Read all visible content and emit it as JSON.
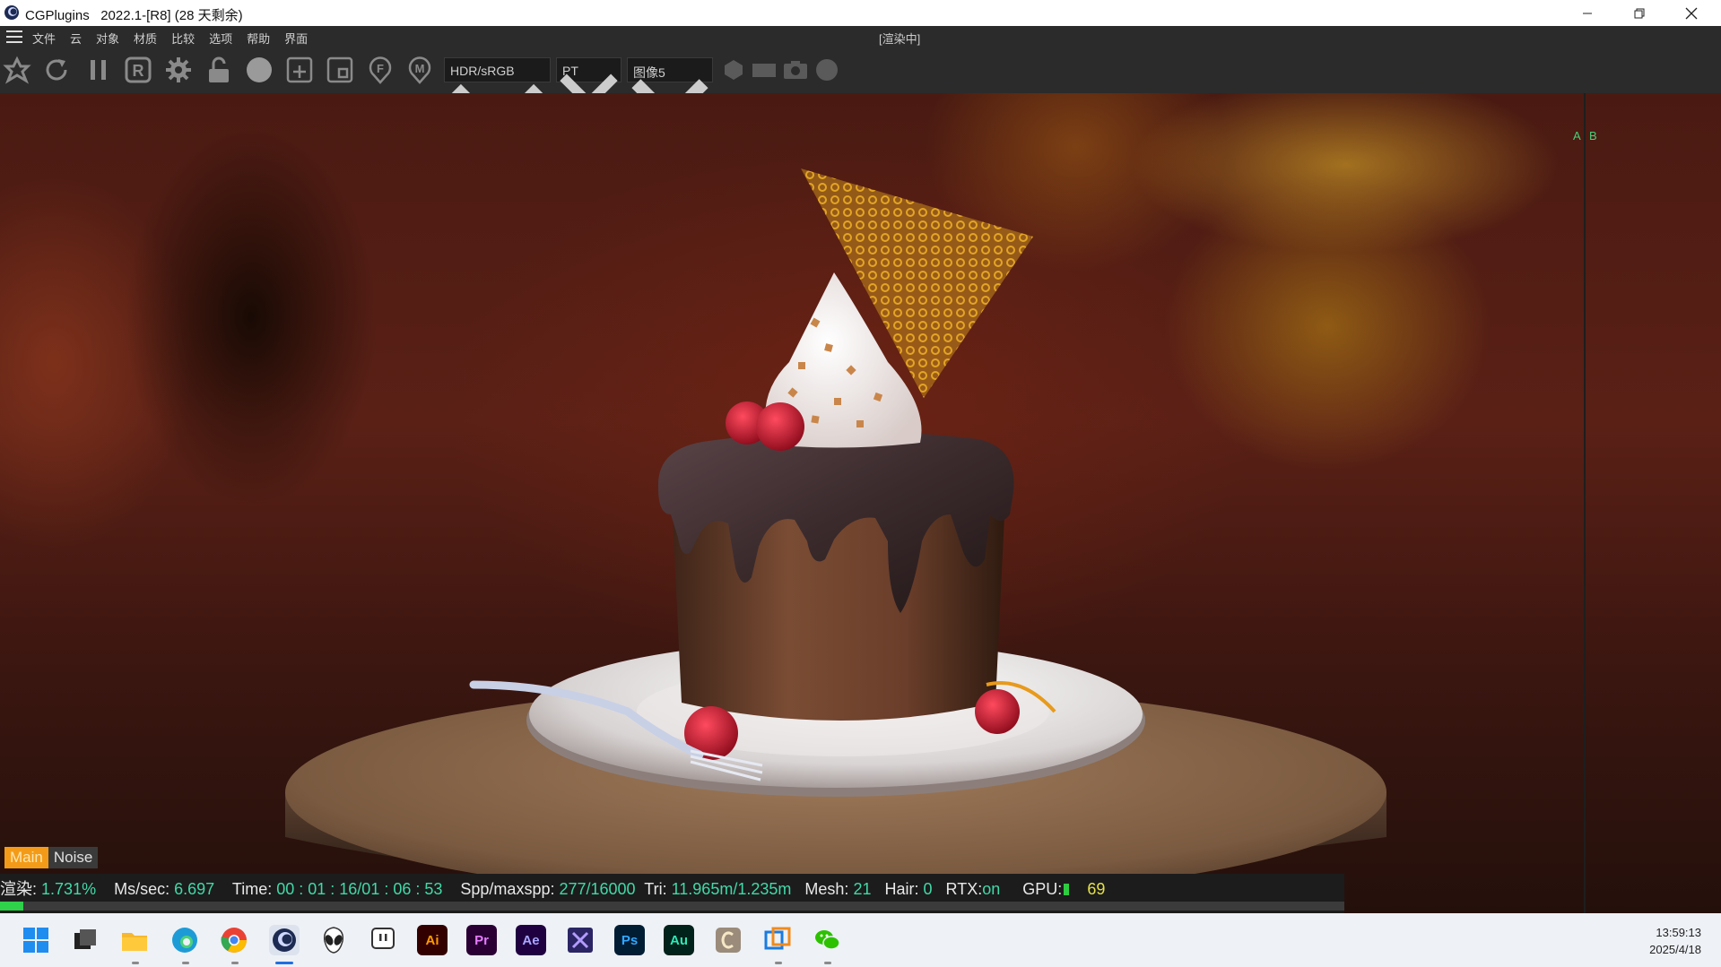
{
  "window": {
    "title": "CGPlugins   2022.1-[R8] (28 天剩余)",
    "controls": {
      "minimize": "minimize",
      "restore": "restore",
      "close": "close"
    }
  },
  "menu": {
    "items": [
      "文件",
      "云",
      "对象",
      "材质",
      "比较",
      "选项",
      "帮助",
      "界面"
    ],
    "status": "[渲染中]"
  },
  "toolbar": {
    "icons": [
      "tools-icon",
      "refresh-icon",
      "pause-icon",
      "region-r-icon",
      "settings-gear-icon",
      "lock-open-icon",
      "sphere-icon",
      "add-frame-icon",
      "frame-icon",
      "focus-f-icon",
      "material-m-icon"
    ],
    "display_mode": "HDR/sRGB",
    "kernel": "PT",
    "image_slot": "图像5",
    "right_icons": [
      "hexagon-icon",
      "rectangle-icon",
      "camera-icon",
      "circle-icon"
    ]
  },
  "viewport": {
    "ab_a": "A",
    "ab_b": "B"
  },
  "render_tabs": {
    "main": "Main",
    "noise": "Noise"
  },
  "render_info": {
    "render_label": "渲染:",
    "render_pct": "1.731%",
    "ms_label": "Ms/sec:",
    "ms_value": "6.697",
    "time_label": "Time:",
    "time_value": "00 : 01 : 16/01 : 06 : 53",
    "spp_label": "Spp/maxspp:",
    "spp_value": "277/16000",
    "tri_label": "Tri:",
    "tri_value": "11.965m/1.235m",
    "mesh_label": "Mesh:",
    "mesh_value": "21",
    "hair_label": "Hair:",
    "hair_value": "0",
    "rtx_label": "RTX:",
    "rtx_value": "on",
    "gpu_label": "GPU:",
    "gpu_value": "69",
    "progress_fraction": 0.01731
  },
  "taskbar": {
    "apps": [
      "start",
      "task-view",
      "file-explorer",
      "edge",
      "chrome",
      "cinema4d",
      "alien",
      "twitch",
      "illustrator",
      "premiere",
      "after-effects",
      "visual-studio",
      "photoshop",
      "audition",
      "c-app",
      "remote",
      "wechat"
    ],
    "adobe": {
      "ai": "Ai",
      "pr": "Pr",
      "ae": "Ae",
      "ps": "Ps",
      "au": "Au"
    },
    "time": "13:59:13",
    "date": "2025/4/18"
  },
  "colors": {
    "accent_orange": "#f39b18",
    "value_green": "#41d9a8",
    "progress_green": "#2fd04a"
  }
}
